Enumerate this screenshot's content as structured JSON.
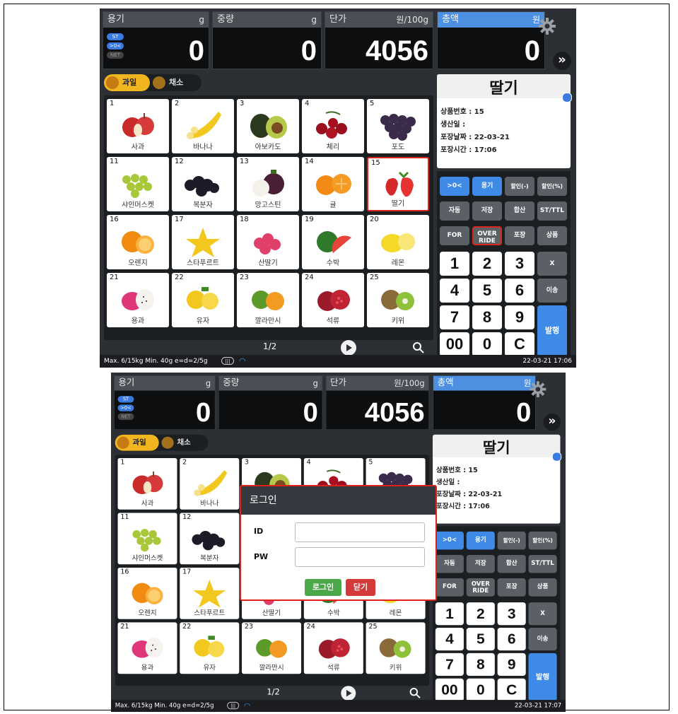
{
  "top_screen": {
    "displays": {
      "container": {
        "label": "용기",
        "unit": "g",
        "value": "0"
      },
      "weight": {
        "label": "중량",
        "unit": "g",
        "value": "0"
      },
      "unit_price": {
        "label": "단가",
        "unit": "원/100g",
        "value": "4056"
      },
      "total": {
        "label": "총액",
        "unit": "원",
        "value": "0"
      }
    },
    "indicators": [
      "ST",
      ">0<",
      "NET"
    ],
    "more_label": "»",
    "categories": [
      {
        "label": "과일",
        "selected": true
      },
      {
        "label": "채소",
        "selected": false
      }
    ],
    "products": [
      {
        "num": "1",
        "name": "사과"
      },
      {
        "num": "2",
        "name": "바나나"
      },
      {
        "num": "3",
        "name": "아보카도"
      },
      {
        "num": "4",
        "name": "체리"
      },
      {
        "num": "5",
        "name": "포도"
      },
      {
        "num": "11",
        "name": "샤인머스켓"
      },
      {
        "num": "12",
        "name": "복분자"
      },
      {
        "num": "13",
        "name": "망고스틴"
      },
      {
        "num": "14",
        "name": "귤"
      },
      {
        "num": "15",
        "name": "딸기"
      },
      {
        "num": "16",
        "name": "오렌지"
      },
      {
        "num": "17",
        "name": "스타푸르트"
      },
      {
        "num": "18",
        "name": "산딸기"
      },
      {
        "num": "19",
        "name": "수박"
      },
      {
        "num": "20",
        "name": "레몬"
      },
      {
        "num": "21",
        "name": "용과"
      },
      {
        "num": "22",
        "name": "유자"
      },
      {
        "num": "23",
        "name": "깔라만시"
      },
      {
        "num": "24",
        "name": "석류"
      },
      {
        "num": "25",
        "name": "키위"
      }
    ],
    "page": "1/2",
    "info": {
      "name": "딸기",
      "product_no": "상품번호 : 15",
      "production_date": "생산일 :",
      "pack_date": "포장날짜 : 22-03-21",
      "pack_time": "포장시간 : 17:06"
    },
    "keys": {
      "zero": ">0<",
      "tare": "용기",
      "disc_amt": "할인(-)",
      "disc_pct": "할인(%)",
      "auto": "자동",
      "save": "저장",
      "sum": "합산",
      "stttl": "ST/TTL",
      "for": "FOR",
      "override1": "OVER",
      "override2": "RIDE",
      "pack": "포장",
      "product": "상품",
      "n1": "1",
      "n2": "2",
      "n3": "3",
      "x": "X",
      "n4": "4",
      "n5": "5",
      "n6": "6",
      "transfer": "이송",
      "n7": "7",
      "n8": "8",
      "n9": "9",
      "issue": "발행",
      "n00": "00",
      "n0": "0",
      "c": "C"
    },
    "status_left": "Max. 6/15kg  Min. 40g  e=d=2/5g",
    "battery": "|||",
    "datetime": "22-03-21 17:06"
  },
  "bottom_screen": {
    "datetime": "22-03-21 17:07",
    "info": {
      "name": "딸기",
      "product_no": "상품번호 : 15",
      "production_date": "생산일 :",
      "pack_date": "포장날짜 : 22-03-21",
      "pack_time": "포장시간 : 17:06"
    }
  },
  "login_dialog": {
    "title": "로그인",
    "id_label": "ID",
    "pw_label": "PW",
    "id_value": "",
    "pw_value": "",
    "login_button": "로그인",
    "close_button": "닫기"
  },
  "colors": {
    "accent_blue": "#3f8ae6",
    "highlight_red": "#d9261c",
    "category_yellow": "#f0b51f"
  }
}
